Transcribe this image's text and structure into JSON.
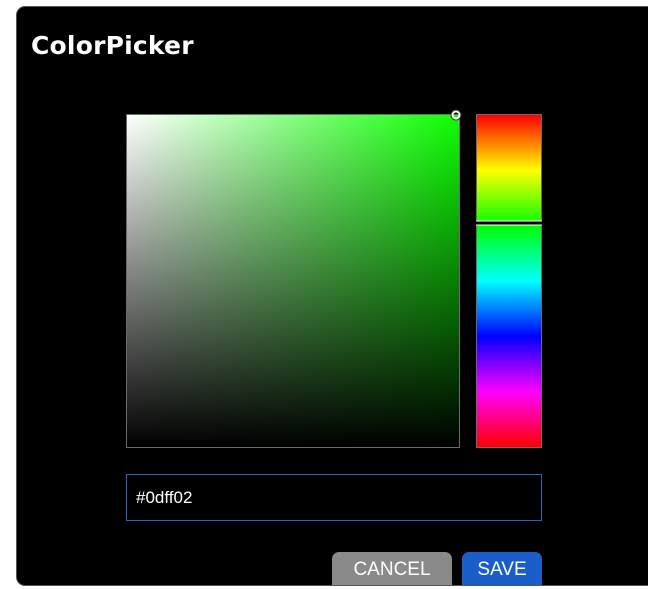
{
  "dialog": {
    "title": "ColorPicker"
  },
  "picker": {
    "hue_color": "#0dff02",
    "hue_fraction": 0.3259,
    "saturation": 0.99,
    "value": 1.0
  },
  "hex_input": {
    "value": "#0dff02"
  },
  "buttons": {
    "cancel_label": "CANCEL",
    "save_label": "SAVE"
  },
  "colors": {
    "dialog_background": "#000000",
    "save_button": "#1a5ec9",
    "cancel_button": "#8a8a8a",
    "input_border": "#2a64b4"
  }
}
